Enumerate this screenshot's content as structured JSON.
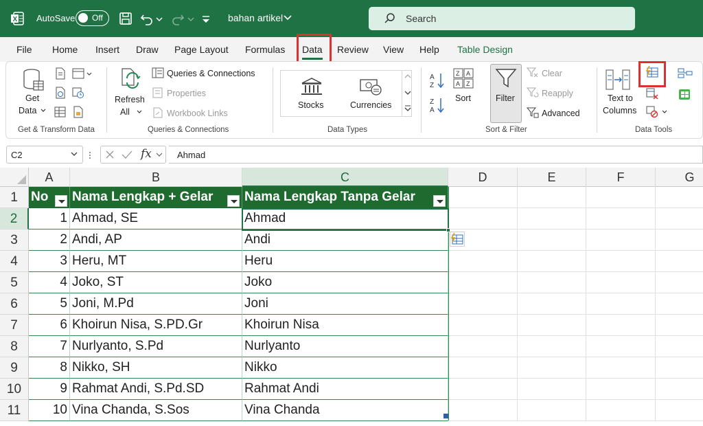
{
  "titlebar": {
    "autosave_label": "AutoSave",
    "autosave_state": "Off",
    "doc_title": "bahan artikel",
    "search_placeholder": "Search"
  },
  "menu": {
    "tabs": [
      "File",
      "Home",
      "Insert",
      "Draw",
      "Page Layout",
      "Formulas",
      "Data",
      "Review",
      "View",
      "Help",
      "Table Design"
    ],
    "active": "Data"
  },
  "ribbon": {
    "get_transform": {
      "get_data": [
        "Get",
        "Data"
      ],
      "label": "Get & Transform Data"
    },
    "queries": {
      "refresh": [
        "Refresh",
        "All"
      ],
      "queries_connections": "Queries & Connections",
      "properties": "Properties",
      "workbook_links": "Workbook Links",
      "label": "Queries & Connections"
    },
    "data_types": {
      "stocks": "Stocks",
      "currencies": "Currencies",
      "label": "Data Types"
    },
    "sort_filter": {
      "sort": "Sort",
      "filter": "Filter",
      "clear": "Clear",
      "reapply": "Reapply",
      "advanced": "Advanced",
      "label": "Sort & Filter"
    },
    "data_tools": {
      "text_to_columns": [
        "Text to",
        "Columns"
      ],
      "label": "Data Tools"
    }
  },
  "formula_bar": {
    "name_box": "C2",
    "fx": "fx",
    "value": "Ahmad"
  },
  "columns": [
    "A",
    "B",
    "C",
    "D",
    "E",
    "F",
    "G"
  ],
  "rows": [
    "1",
    "2",
    "3",
    "4",
    "5",
    "6",
    "7",
    "8",
    "9",
    "10",
    "11"
  ],
  "table": {
    "headers": [
      "No",
      "Nama Lengkap + Gelar",
      "Nama Lengkap Tanpa Gelar"
    ],
    "data": [
      [
        "1",
        "Ahmad, SE",
        "Ahmad"
      ],
      [
        "2",
        "Andi, AP",
        "Andi"
      ],
      [
        "3",
        "Heru, MT",
        "Heru"
      ],
      [
        "4",
        "Joko, ST",
        "Joko"
      ],
      [
        "5",
        "Joni, M.Pd",
        "Joni"
      ],
      [
        "6",
        "Khoirun Nisa, S.PD.Gr",
        "Khoirun Nisa"
      ],
      [
        "7",
        "Nurlyanto, S.Pd",
        "Nurlyanto"
      ],
      [
        "8",
        "Nikko, SH",
        "Nikko"
      ],
      [
        "9",
        "Rahmat Andi, S.Pd.SD",
        "Rahmat Andi"
      ],
      [
        "10",
        "Vina Chanda, S.Sos",
        "Vina Chanda"
      ]
    ]
  },
  "colors": {
    "excel_green": "#1f7244",
    "table_header": "#1f6b2f",
    "highlight_red": "#d83232"
  }
}
